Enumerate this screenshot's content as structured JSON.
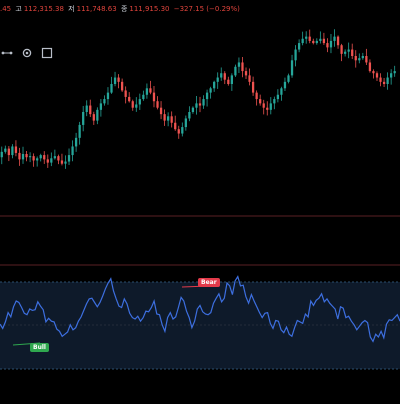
{
  "header": {
    "open_value": ".45",
    "high_key": "고",
    "high_value": "112,315.38",
    "low_key": "저",
    "low_value": "111,748.63",
    "close_key": "종",
    "close_value": "111,915.30",
    "change": "−327.15 (−0.29%)"
  },
  "toolbar": {
    "icons": [
      "drawing-node-icon",
      "settings-icon",
      "fullscreen-icon"
    ]
  },
  "colors": {
    "background": "#000000",
    "up_candle": "#26a69a",
    "down_candle": "#ef5350",
    "oscillator_line": "#3d6fe0",
    "oscillator_band": "#0e1a2a",
    "separator": "#5a1f24",
    "bear_label": "#e33a4a",
    "bull_label": "#2fa84f"
  },
  "signals": {
    "bear": "Bear",
    "bull": "Bull"
  },
  "chart_data": [
    {
      "type": "candlestick",
      "title": "",
      "series": [
        {
          "close_path": [
            150,
            145,
            142,
            148,
            140,
            146,
            152,
            147,
            150,
            149,
            153,
            151,
            148,
            152,
            155,
            151,
            149,
            153,
            156,
            154,
            148,
            140,
            132,
            120,
            108,
            102,
            110,
            116,
            106,
            100,
            96,
            90,
            82,
            76,
            80,
            88,
            94,
            98,
            104,
            101,
            96,
            92,
            86,
            90,
            98,
            104,
            110,
            116,
            112,
            118,
            124,
            128,
            122,
            114,
            108,
            104,
            100,
            102,
            96,
            90,
            86,
            80,
            76,
            72,
            78,
            82,
            74,
            66,
            62,
            70,
            74,
            80,
            90,
            96,
            100,
            104,
            106,
            100,
            96,
            92,
            86,
            80,
            74,
            60,
            50,
            44,
            40,
            38,
            42,
            44,
            42,
            40,
            44,
            48,
            42,
            38,
            46,
            54,
            52,
            50,
            56,
            60,
            58,
            56,
            62,
            70,
            72,
            76,
            80,
            82,
            76,
            72,
            70
          ]
        }
      ]
    },
    {
      "type": "line",
      "title": "",
      "series": [
        {
          "values": [
            0.36,
            0.3,
            0.39,
            0.52,
            0.46,
            0.6,
            0.68,
            0.66,
            0.59,
            0.51,
            0.49,
            0.57,
            0.55,
            0.56,
            0.67,
            0.61,
            0.56,
            0.39,
            0.44,
            0.4,
            0.39,
            0.29,
            0.26,
            0.19,
            0.22,
            0.25,
            0.35,
            0.28,
            0.31,
            0.4,
            0.46,
            0.55,
            0.64,
            0.71,
            0.72,
            0.66,
            0.6,
            0.66,
            0.75,
            0.85,
            0.93,
            0.99,
            0.82,
            0.71,
            0.61,
            0.59,
            0.71,
            0.64,
            0.51,
            0.45,
            0.43,
            0.47,
            0.4,
            0.45,
            0.54,
            0.53,
            0.59,
            0.68,
            0.5,
            0.49,
            0.35,
            0.26,
            0.45,
            0.52,
            0.43,
            0.46,
            0.59,
            0.73,
            0.68,
            0.54,
            0.45,
            0.31,
            0.4,
            0.57,
            0.62,
            0.53,
            0.5,
            0.49,
            0.52,
            0.65,
            0.72,
            0.78,
            0.67,
            0.72,
            0.93,
            0.89,
            0.77,
            0.96,
            1.02,
            0.89,
            0.9,
            0.74,
            0.65,
            0.77,
            0.68,
            0.6,
            0.52,
            0.45,
            0.51,
            0.52,
            0.37,
            0.3,
            0.41,
            0.4,
            0.28,
            0.24,
            0.32,
            0.22,
            0.19,
            0.31,
            0.41,
            0.39,
            0.37,
            0.5,
            0.46,
            0.68,
            0.62,
            0.69,
            0.72,
            0.78,
            0.67,
            0.71,
            0.65,
            0.61,
            0.57,
            0.43,
            0.6,
            0.58,
            0.45,
            0.47,
            0.4,
            0.35,
            0.28,
            0.33,
            0.38,
            0.41,
            0.38,
            0.18,
            0.12,
            0.22,
            0.18,
            0.26,
            0.17,
            0.36,
            0.42,
            0.41,
            0.45,
            0.49,
            0.4
          ]
        }
      ],
      "ylim": [
        0,
        1
      ],
      "grid": false
    }
  ]
}
